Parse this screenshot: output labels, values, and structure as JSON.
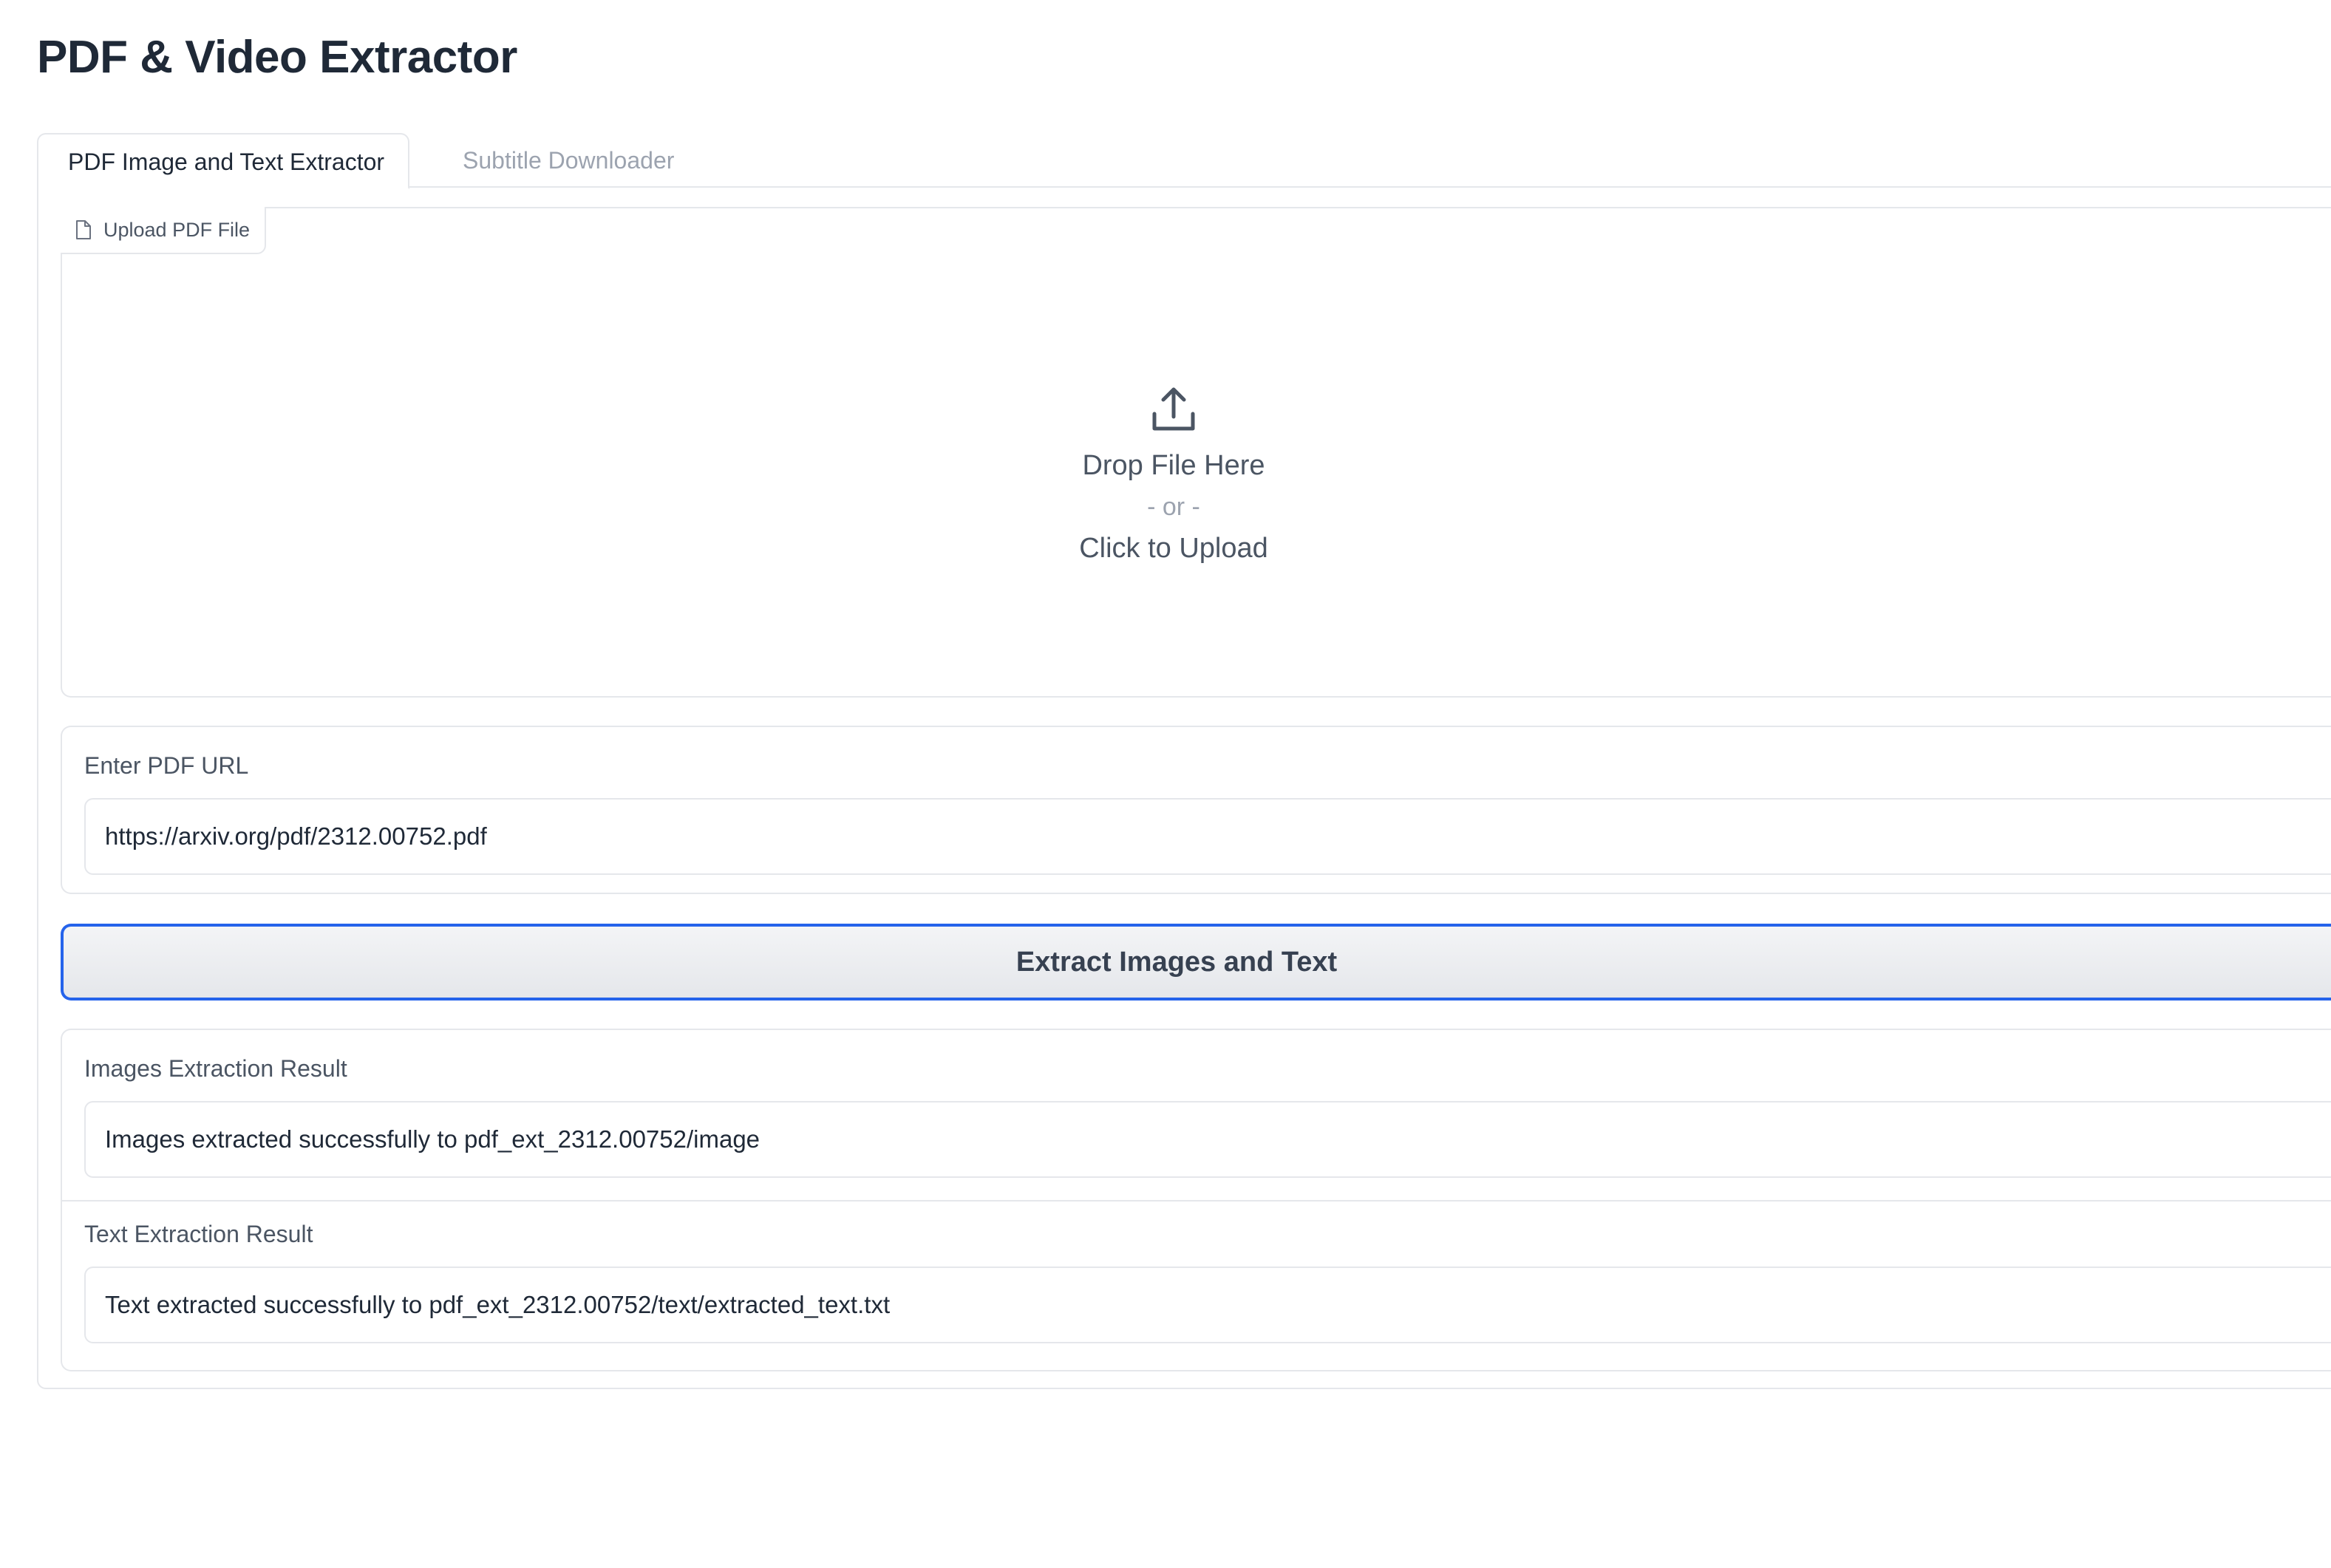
{
  "app": {
    "title": "PDF & Video Extractor"
  },
  "tabs": [
    {
      "label": "PDF Image and Text Extractor",
      "active": true
    },
    {
      "label": "Subtitle Downloader",
      "active": false
    }
  ],
  "upload": {
    "label": "Upload PDF File",
    "icon": "file-icon",
    "drop_icon": "upload-icon",
    "drop_text": "Drop File Here",
    "or_text": "- or -",
    "click_text": "Click to Upload"
  },
  "url_input": {
    "label": "Enter PDF URL",
    "value": "https://arxiv.org/pdf/2312.00752.pdf"
  },
  "extract_button": {
    "label": "Extract Images and Text"
  },
  "results": {
    "images": {
      "label": "Images Extraction Result",
      "value": "Images extracted successfully to pdf_ext_2312.00752/image"
    },
    "text": {
      "label": "Text Extraction Result",
      "value": "Text extracted successfully to pdf_ext_2312.00752/text/extracted_text.txt"
    }
  },
  "colors": {
    "accent": "#2563eb",
    "border": "#e5e7eb",
    "text": "#1f2937",
    "muted": "#9ca3af"
  }
}
